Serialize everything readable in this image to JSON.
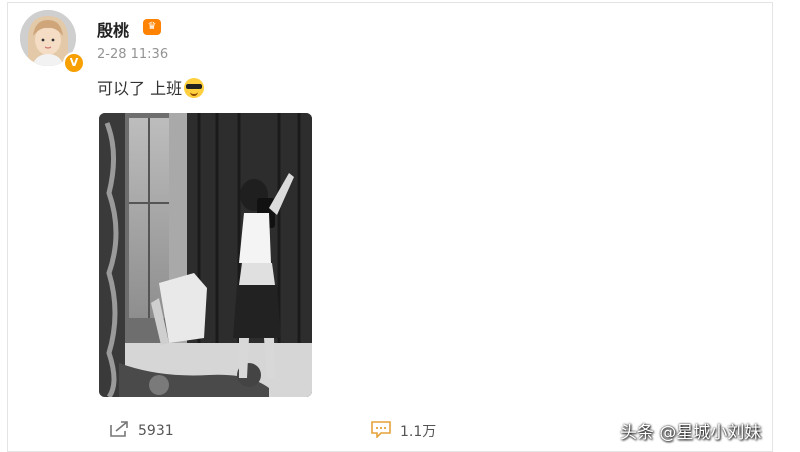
{
  "post": {
    "author": "殷桃",
    "time": "2-28 11:36",
    "text": "可以了 上班"
  },
  "icons": {
    "verified_badge": "verified-v-icon",
    "member_badge": "weibo-member-icon",
    "emoji": "sunglasses-emoji-icon",
    "share": "share-arrow-icon",
    "comment": "comment-bubble-icon"
  },
  "actions": {
    "share_count": "5931",
    "comment_count": "1.1万"
  },
  "watermark": "头条 @星城小刘妹",
  "colors": {
    "accent_orange": "#ff8200",
    "verify_orange": "#f7a000",
    "time_gray": "#939393"
  }
}
